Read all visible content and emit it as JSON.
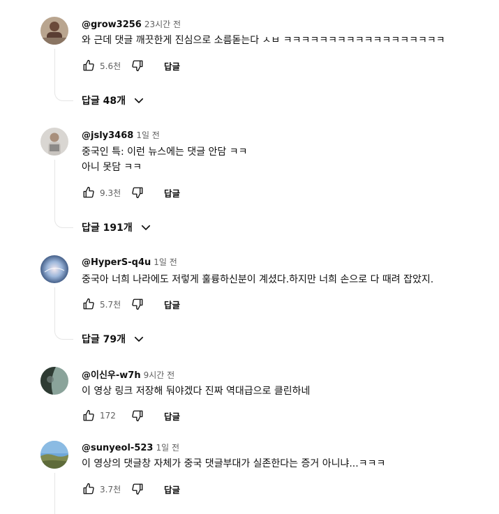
{
  "comments": [
    {
      "author": "@grow3256",
      "time": "23시간 전",
      "text": "와 근데 댓글 깨끗한게 진심으로 소름돋는다 ㅅㅂ ㅋㅋㅋㅋㅋㅋㅋㅋㅋㅋㅋㅋㅋㅋㅋㅋㅋㅋ",
      "likes": "5.6천",
      "reply_label": "답글",
      "replies_label": "답글 48개",
      "avatar_colors": [
        "#6b4a3a",
        "#b9a58f"
      ]
    },
    {
      "author": "@jsly3468",
      "time": "1일 전",
      "text": "중국인 특: 이런 뉴스에는 댓글 안담 ㅋㅋ\n아니 못담 ㅋㅋ",
      "likes": "9.3천",
      "reply_label": "답글",
      "replies_label": "답글 191개",
      "avatar_colors": [
        "#d9d6d2",
        "#8c8a88"
      ]
    },
    {
      "author": "@HyperS-q4u",
      "time": "1일 전",
      "text": "중국아 너희 나라에도 저렇게 훌륭하신분이 계셨다.하지만 너희 손으로 다 때려 잡았지.",
      "likes": "5.7천",
      "reply_label": "답글",
      "replies_label": "답글 79개",
      "avatar_colors": [
        "#2b4d7a",
        "#c9d8ec"
      ]
    },
    {
      "author": "@이신우-w7h",
      "time": "9시간 전",
      "text": "이 영상 링크 저장해 둬야겠다 진짜 역대급으로 클린하네",
      "likes": "172",
      "reply_label": "답글",
      "avatar_colors": [
        "#2e3b33",
        "#8aa39a"
      ]
    },
    {
      "author": "@sunyeol-523",
      "time": "1일 전",
      "text": "이 영상의 댓글창 자체가 중국 댓글부대가 실존한다는 증거 아니냐...ㅋㅋㅋ",
      "likes": "3.7천",
      "reply_label": "답글",
      "avatar_colors": [
        "#6fa7d8",
        "#7f8a4f"
      ]
    }
  ]
}
